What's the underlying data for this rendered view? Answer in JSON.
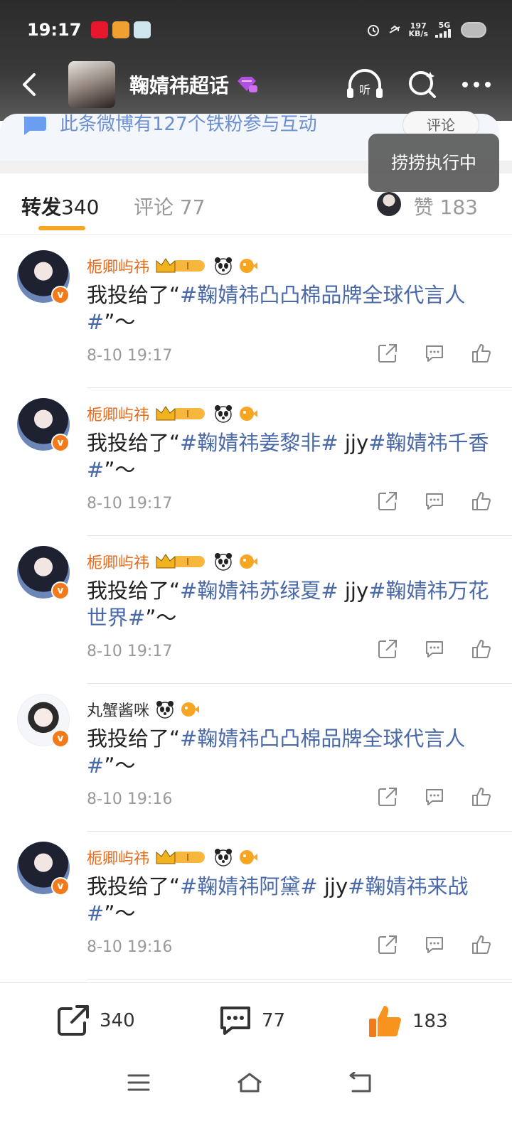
{
  "status_bar": {
    "time": "19:17",
    "speed_value": "197",
    "speed_unit": "KB/s",
    "network": "5G"
  },
  "nav": {
    "title": "鞠婧祎超话"
  },
  "peek": {
    "text": "此条微博有127个铁粉参与互动",
    "button": "评论"
  },
  "toast": "捞捞执行中",
  "tabs": {
    "repost_label": "转发",
    "repost_count": "340",
    "comment_label": "评论",
    "comment_count": "77",
    "like_label": "赞",
    "like_count": "183"
  },
  "items": [
    {
      "user": "栀卿屿祎",
      "prefix": "我投给了“",
      "tag1": "#鞠婧祎凸凸棉品牌全球代言人#",
      "mid": "",
      "tag2": "",
      "suffix": "”～",
      "time": "8-10 19:17"
    },
    {
      "user": "栀卿屿祎",
      "prefix": "我投给了“",
      "tag1": "#鞠婧祎姜黎非#",
      "mid": " jjy",
      "tag2": "#鞠婧祎千香#",
      "suffix": "”～",
      "time": "8-10 19:17"
    },
    {
      "user": "栀卿屿祎",
      "prefix": "我投给了“",
      "tag1": "#鞠婧祎苏绿夏#",
      "mid": " jjy",
      "tag2": "#鞠婧祎万花世界#",
      "suffix": "”～",
      "time": "8-10 19:17"
    },
    {
      "user": "丸蟹酱咪",
      "prefix": "我投给了“",
      "tag1": "#鞠婧祎凸凸棉品牌全球代言人#",
      "mid": "",
      "tag2": "",
      "suffix": "”～",
      "time": "8-10 19:16"
    },
    {
      "user": "栀卿屿祎",
      "prefix": "我投给了“",
      "tag1": "#鞠婧祎阿黛#",
      "mid": " jjy",
      "tag2": "#鞠婧祎来战#",
      "suffix": "”～",
      "time": "8-10 19:16"
    }
  ],
  "bottom_bar": {
    "repost_count": "340",
    "comment_count": "77",
    "like_count": "183"
  },
  "colors": {
    "accent_orange": "#f5a623",
    "username_orange": "#e86a1a",
    "topic_blue": "#4a69a8"
  }
}
